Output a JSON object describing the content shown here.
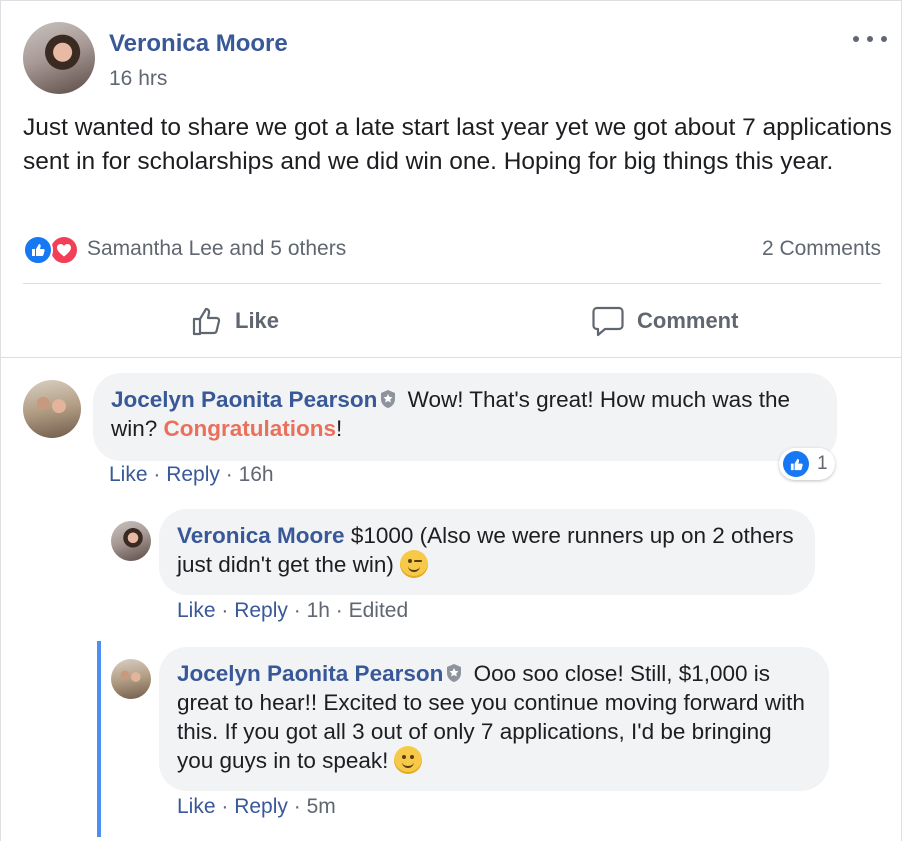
{
  "post": {
    "author": "Veronica Moore",
    "time": "16 hrs",
    "text": "Just wanted to share we got a late start last year yet we got about 7 applications sent in for scholarships and we did win one. Hoping for big things this year.",
    "reactions_label": "Samantha Lee and 5 others",
    "comments_label": "2 Comments",
    "reaction_icons": [
      "like-icon",
      "love-icon"
    ]
  },
  "actions": {
    "like": "Like",
    "comment": "Comment"
  },
  "comments": [
    {
      "author": "Jocelyn Paonita Pearson",
      "text_part1": " Wow! That's great! How much was the win? ",
      "highlight": "Congratulations",
      "text_part2": "!",
      "like": "Like",
      "reply": "Reply",
      "time": "16h",
      "reaction_count": "1"
    },
    {
      "author": "Veronica Moore",
      "text": " $1000 (Also we were runners up on 2 others just didn't get the win)",
      "like": "Like",
      "reply": "Reply",
      "time": "1h",
      "edited": "Edited"
    },
    {
      "author": "Jocelyn Paonita Pearson",
      "text": " Ooo soo close! Still, $1,000 is great to hear!! Excited to see you continue moving forward with this. If you got all 3 out of only 7 applications, I'd be bringing you guys in to speak!",
      "like": "Like",
      "reply": "Reply",
      "time": "5m"
    }
  ],
  "separator": " · ",
  "colors": {
    "name_link": "#385898",
    "highlight": "#e9705b",
    "like_blue": "#1877f2",
    "love_red": "#f33e58",
    "thread_line": "#4c8ff0"
  }
}
